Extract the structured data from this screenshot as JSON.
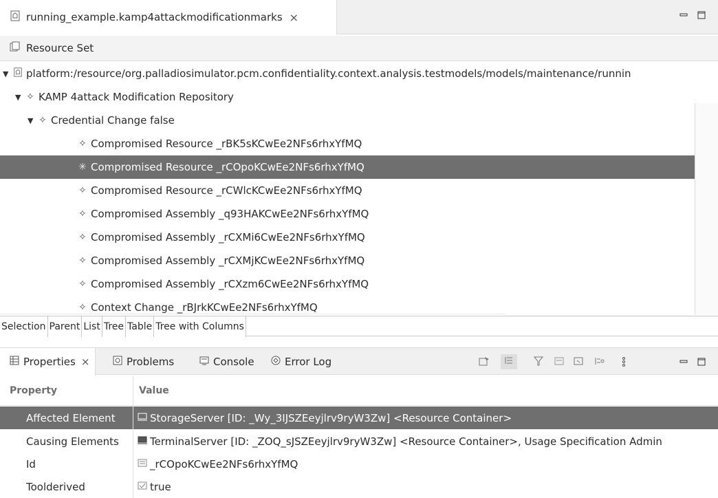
{
  "editor": {
    "tab_title": "running_example.kamp4attackmodificationmarks",
    "close_glyph": "×",
    "minimize_glyph": "▭",
    "maximize_glyph": "◻"
  },
  "resource_set": {
    "label": "Resource Set"
  },
  "tree": {
    "root": "platform:/resource/org.palladiosimulator.pcm.confidentiality.context.analysis.testmodels/models/maintenance/runnin",
    "repository": "KAMP 4attack Modification Repository",
    "credential_change": "Credential Change false",
    "items": [
      "Compromised Resource _rBK5sKCwEe2NFs6rhxYfMQ",
      "Compromised Resource _rCOpoKCwEe2NFs6rhxYfMQ",
      "Compromised Resource _rCWlcKCwEe2NFs6rhxYfMQ",
      "Compromised Assembly _q93HAKCwEe2NFs6rhxYfMQ",
      "Compromised Assembly _rCXMi6CwEe2NFs6rhxYfMQ",
      "Compromised Assembly _rCXMjKCwEe2NFs6rhxYfMQ",
      "Compromised Assembly _rCXzm6CwEe2NFs6rhxYfMQ",
      "Context Change _rBJrkKCwEe2NFs6rhxYfMQ"
    ]
  },
  "page_tabs": [
    "Selection",
    "Parent",
    "List",
    "Tree",
    "Table",
    "Tree with Columns"
  ],
  "views": {
    "properties": "Properties",
    "problems": "Problems",
    "console": "Console",
    "error_log": "Error Log"
  },
  "properties": {
    "col_property": "Property",
    "col_value": "Value",
    "rows": [
      {
        "name": "Affected Element",
        "value": "StorageServer [ID: _Wy_3IJSZEeyjlrv9ryW3Zw] <Resource Container>"
      },
      {
        "name": "Causing Elements",
        "value": "TerminalServer [ID: _ZOQ_sJSZEeyjlrv9ryW3Zw] <Resource Container>, Usage Specification Admin"
      },
      {
        "name": "Id",
        "value": "_rCOpoKCwEe2NFs6rhxYfMQ"
      },
      {
        "name": "Toolderived",
        "value": "true"
      }
    ]
  },
  "colors": {
    "selection": "#6f6f6f",
    "chrome": "#f0f0f0"
  }
}
